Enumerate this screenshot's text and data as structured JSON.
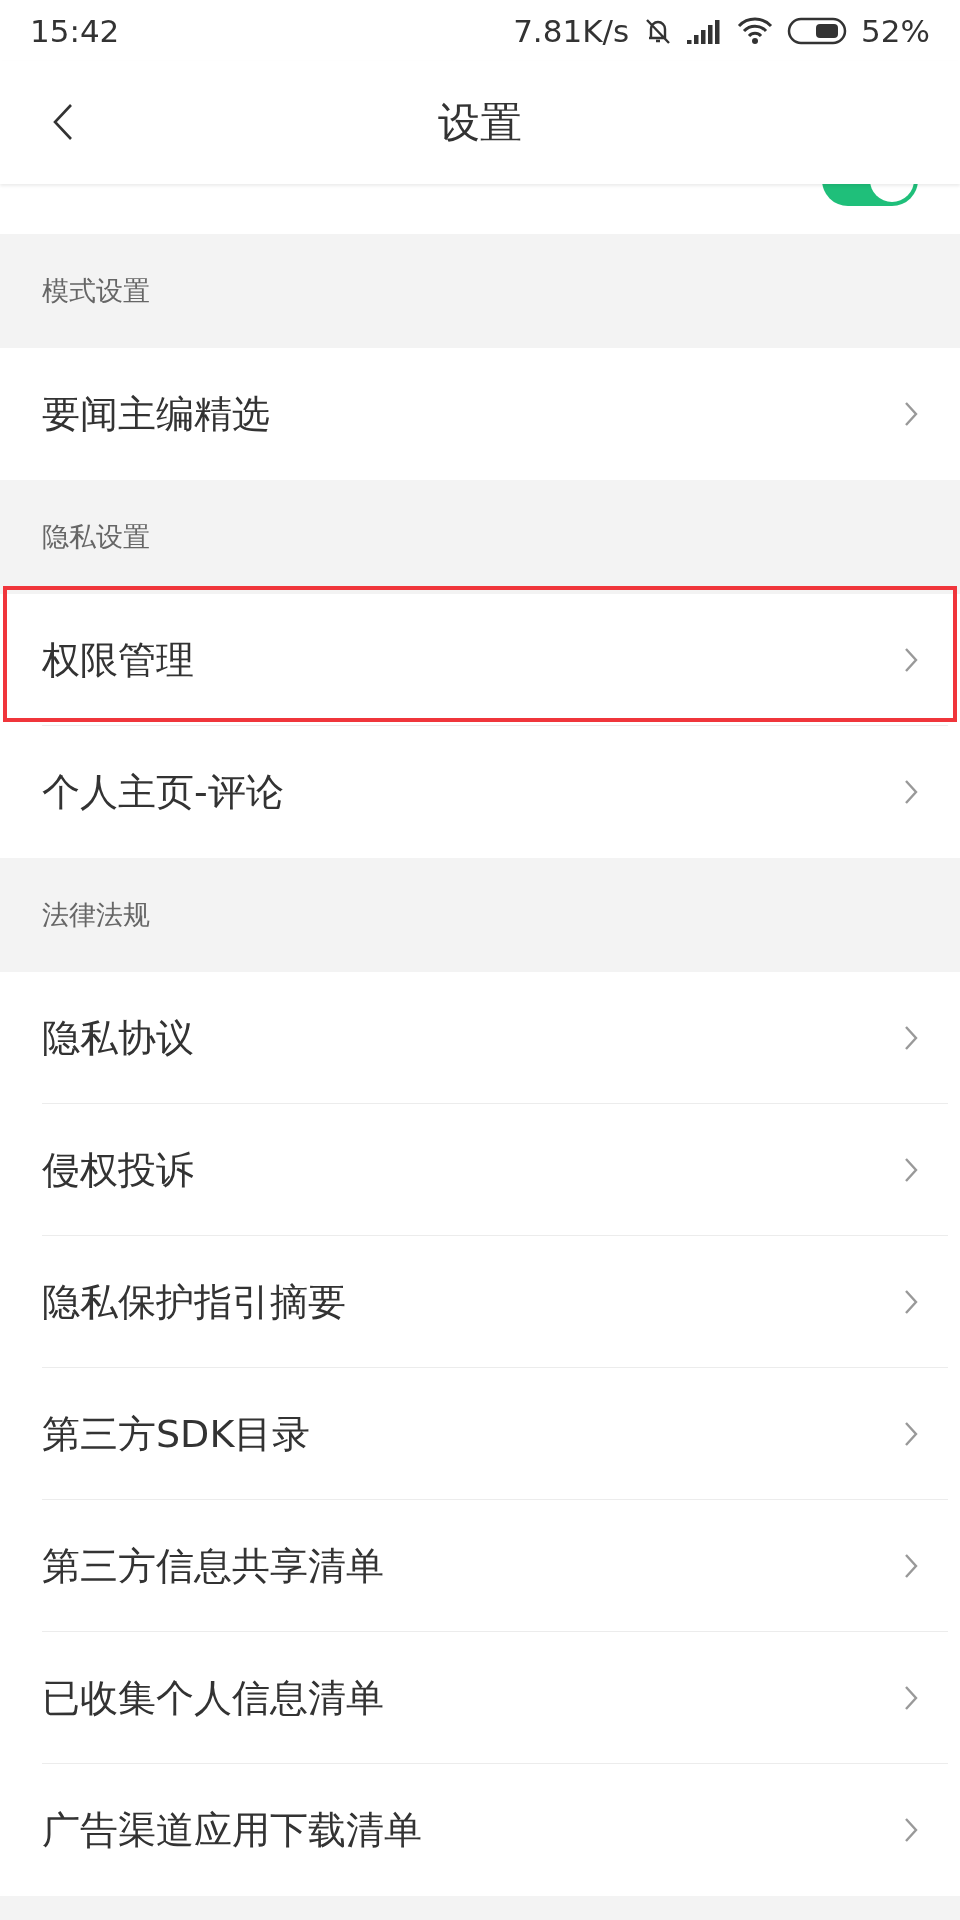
{
  "status_bar": {
    "time": "15:42",
    "speed": "7.81K/s",
    "battery_text": "52%"
  },
  "header": {
    "title": "设置"
  },
  "partial_row": {
    "on": true
  },
  "sections": [
    {
      "title": "模式设置",
      "items": [
        {
          "label": "要闻主编精选",
          "highlighted": false
        }
      ]
    },
    {
      "title": "隐私设置",
      "items": [
        {
          "label": "权限管理",
          "highlighted": true
        },
        {
          "label": "个人主页-评论",
          "highlighted": false
        }
      ]
    },
    {
      "title": "法律法规",
      "items": [
        {
          "label": "隐私协议",
          "highlighted": false
        },
        {
          "label": "侵权投诉",
          "highlighted": false
        },
        {
          "label": "隐私保护指引摘要",
          "highlighted": false
        },
        {
          "label": "第三方SDK目录",
          "highlighted": false
        },
        {
          "label": "第三方信息共享清单",
          "highlighted": false
        },
        {
          "label": "已收集个人信息清单",
          "highlighted": false
        },
        {
          "label": "广告渠道应用下载清单",
          "highlighted": false
        }
      ]
    }
  ]
}
